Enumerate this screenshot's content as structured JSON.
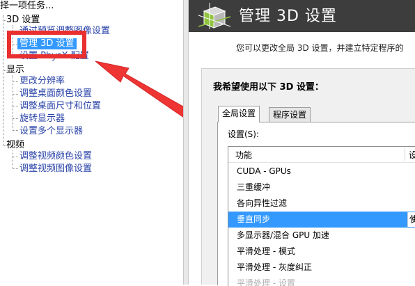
{
  "left_panel": {
    "title": "择一项任务...",
    "categories": {
      "3d": "3D 设置",
      "display": "显示",
      "video": "视频"
    },
    "items_3d": [
      "通过预览调整图像设置",
      "管理 3D 设置",
      "设置 PhysX 配置"
    ],
    "items_display": [
      "更改分辨率",
      "调整桌面颜色设置",
      "调整桌面尺寸和位置",
      "旋转显示器",
      "设置多个显示器"
    ],
    "items_video": [
      "调整视频颜色设置",
      "调整视频图像设置"
    ]
  },
  "header": {
    "title": "管理 3D 设置",
    "logo_icon": "nvidia-3d-cube-icon"
  },
  "description": "您可以更改全局 3D 设置，并建立特定程序的",
  "panel": {
    "heading": "我希望使用以下 3D 设置：",
    "tabs": [
      "全局设置",
      "程序设置"
    ],
    "active_tab": "全局设置",
    "settings_label": "设置(S):",
    "columns": [
      "功能",
      "设"
    ],
    "features": [
      {
        "name": "CUDA - GPUs",
        "value": ""
      },
      {
        "name": "三重缓冲",
        "value": ""
      },
      {
        "name": "各向异性过滤",
        "value": ""
      },
      {
        "name": "垂直同步",
        "value": "使"
      },
      {
        "name": "多显示器/混合 GPU 加速",
        "value": ""
      },
      {
        "name": "平滑处理 - 模式",
        "value": ""
      },
      {
        "name": "平滑处理 - 灰度纠正",
        "value": ""
      },
      {
        "name": "平滑处理 - 设置",
        "value": ""
      }
    ],
    "selected_feature": "垂直同步"
  },
  "colors": {
    "header_bg": "#3d3d3d",
    "selection": "#3399ff",
    "callout": "#ea2f2f",
    "link": "#2a44a8"
  }
}
